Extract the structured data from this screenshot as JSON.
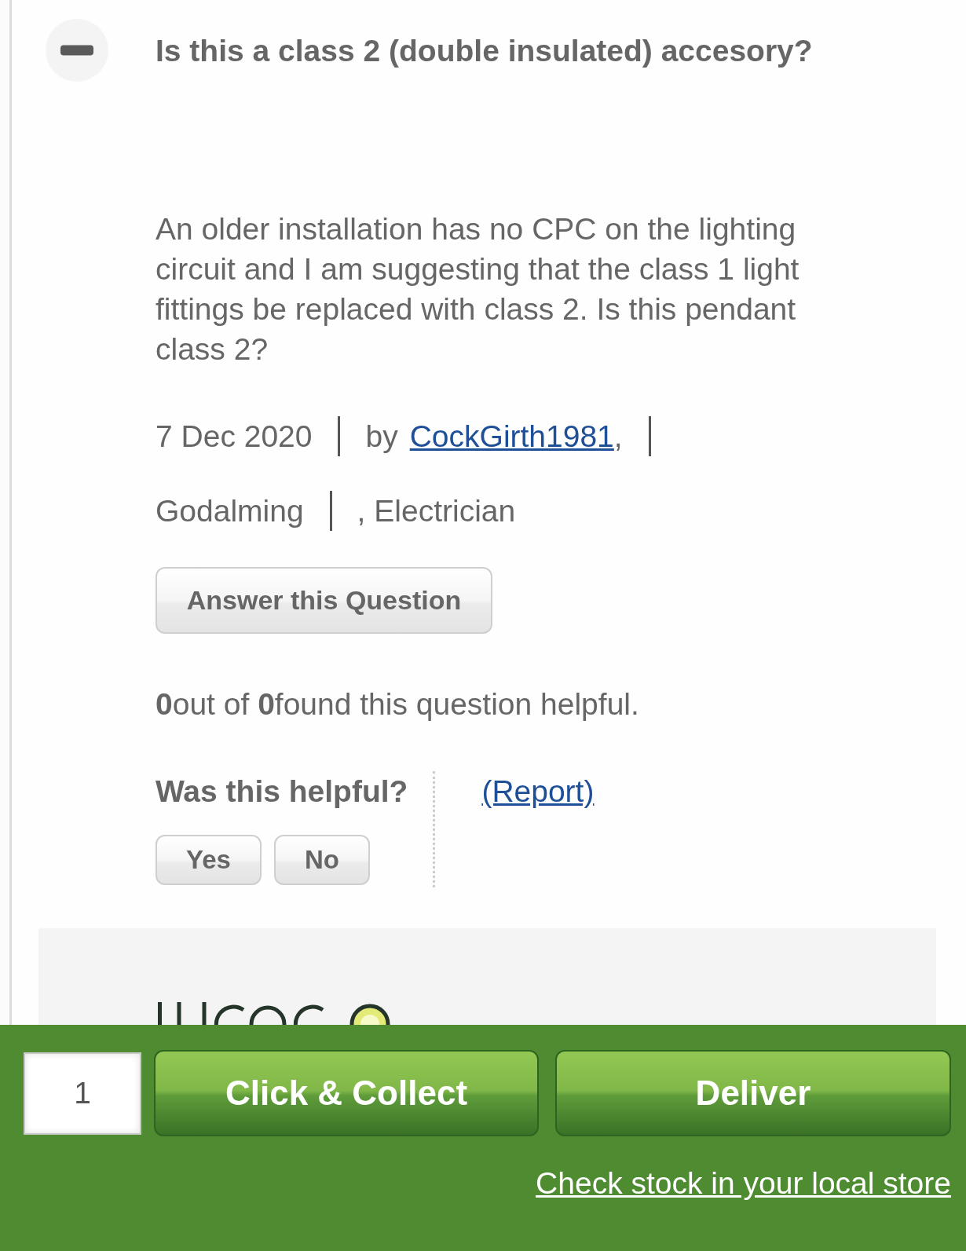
{
  "question": {
    "expanded": true,
    "title": "Is this a class 2 (double insulated) accesory?",
    "body": "An older installation has no CPC on the lighting circuit and I am suggesting that the class 1 light fittings be replaced with class 2. Is this pendant class 2?",
    "meta": [
      {
        "kind": "date",
        "text": "7 Dec 2020"
      },
      {
        "kind": "author",
        "label": "by",
        "name": "CockGirth1981",
        "suffix": ","
      },
      {
        "kind": "location",
        "text": "Godalming"
      },
      {
        "kind": "occupation",
        "text": ", Electrician"
      }
    ],
    "answer_button": "Answer this Question",
    "helpful_summary": "**0**out of **0**found this question helpful.",
    "helpful_prompt": "Was this helpful?",
    "vote_buttons": [
      "Yes",
      "No"
    ],
    "report_link": "(Report)"
  },
  "purchase_bar": {
    "quantity": "1",
    "buttons": [
      "Click & Collect",
      "Deliver"
    ],
    "stock_link": "Check stock in your local store"
  }
}
